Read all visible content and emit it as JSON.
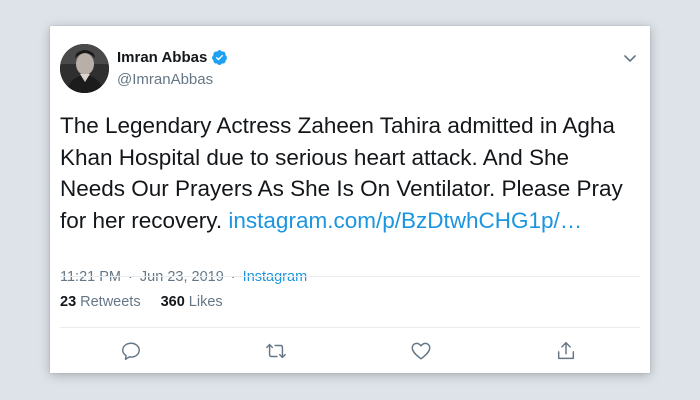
{
  "tweet": {
    "author": {
      "display_name": "Imran Abbas",
      "handle": "@ImranAbbas",
      "verified": true
    },
    "text": "The Legendary Actress Zaheen Tahira admitted in Agha Khan Hospital due to serious heart attack. And She Needs Our Prayers As She Is On Ventilator. Please Pray for her recovery.",
    "link_text": "instagram.com/p/BzDtwhCHG1p/…",
    "time": "11:21 PM",
    "separator": "·",
    "date": "Jun 23, 2019",
    "source": "Instagram",
    "retweets": {
      "count": "23",
      "label": "Retweets"
    },
    "likes": {
      "count": "360",
      "label": "Likes"
    }
  },
  "icons": {
    "verified": "verified-badge-icon",
    "caret": "chevron-down-icon",
    "reply": "reply-icon",
    "retweet": "retweet-icon",
    "like": "heart-icon",
    "share": "share-icon"
  },
  "colors": {
    "background": "#dde3e9",
    "card": "#ffffff",
    "text": "#14171a",
    "secondary": "#657786",
    "link": "#1b95e0",
    "verified": "#1da1f2"
  }
}
